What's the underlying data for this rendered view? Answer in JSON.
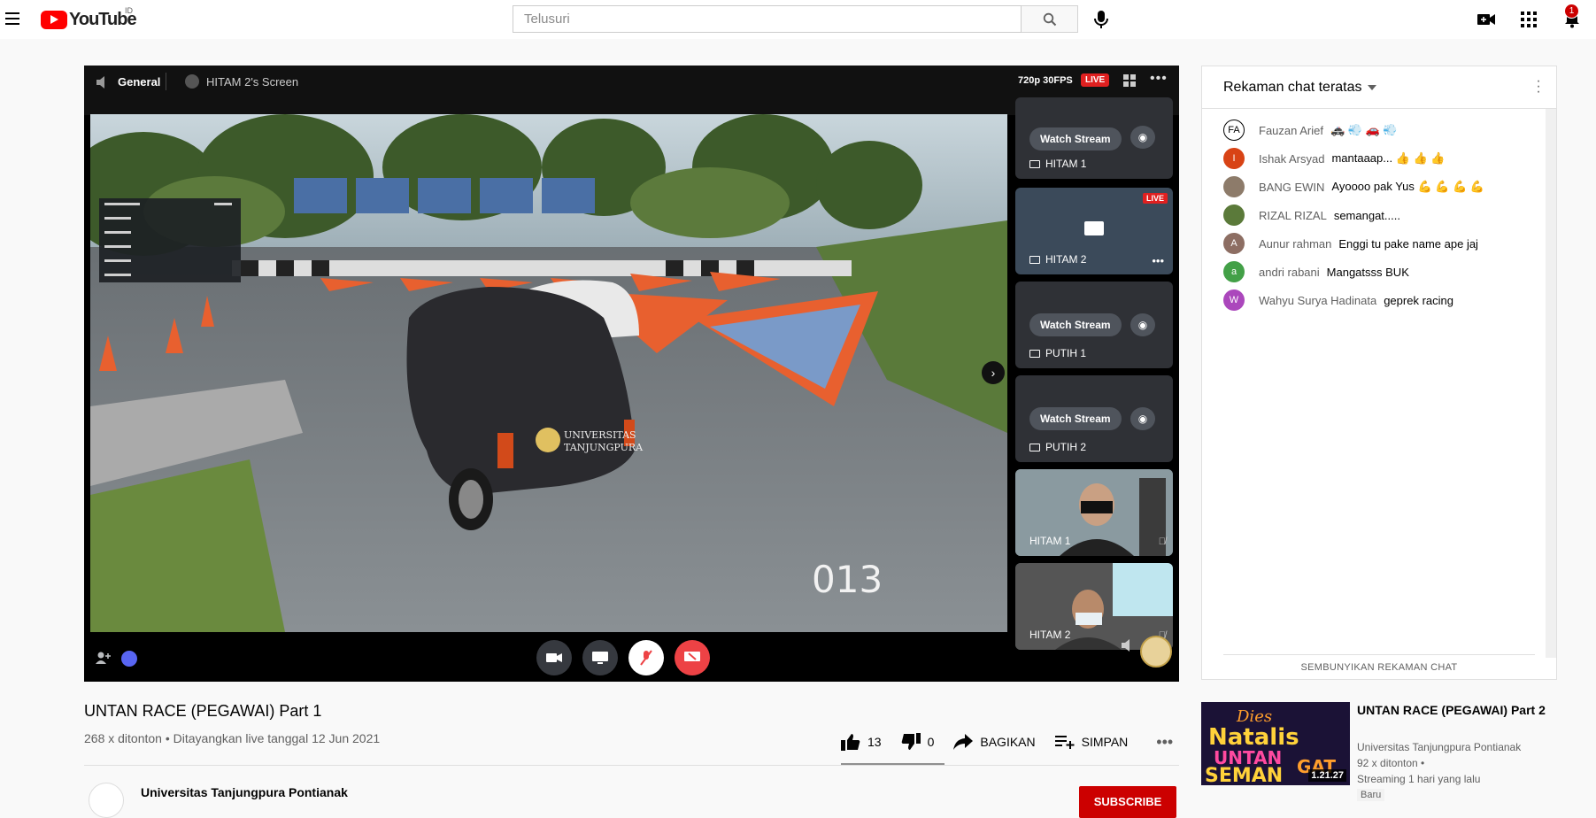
{
  "header": {
    "logo_text": "YouTube",
    "country_code": "ID",
    "search_placeholder": "Telusuri",
    "notification_count": "1"
  },
  "player": {
    "channel_name": "General",
    "screen_label": "HITAM 2's Screen",
    "quality": "720p 30FPS",
    "live_label": "LIVE",
    "overlay_lap_number": "013",
    "tiles": [
      {
        "label": "HITAM 1",
        "button": "Watch Stream"
      },
      {
        "label": "HITAM 2",
        "live": "LIVE"
      },
      {
        "label": "PUTIH 1",
        "button": "Watch Stream"
      },
      {
        "label": "PUTIH 2",
        "button": "Watch Stream"
      },
      {
        "label": "HITAM 1"
      },
      {
        "label": "HITAM 2"
      }
    ]
  },
  "video": {
    "title": "UNTAN RACE (PEGAWAI) Part 1",
    "meta": "268 x ditonton • Ditayangkan live tanggal 12 Jun 2021",
    "likes": "13",
    "dislikes": "0",
    "share_label": "BAGIKAN",
    "save_label": "SIMPAN",
    "channel_name": "Universitas Tanjungpura Pontianak",
    "subscribe_label": "SUBSCRIBE"
  },
  "chat": {
    "title": "Rekaman chat teratas",
    "footer": "SEMBUNYIKAN REKAMAN CHAT",
    "messages": [
      {
        "initial": "FA",
        "author": "Fauzan Arief",
        "text": "🚓 💨 🚗 💨",
        "color": "#ffffff"
      },
      {
        "initial": "I",
        "author": "Ishak Arsyad",
        "text": "mantaaap... 👍 👍 👍",
        "color": "#d84315"
      },
      {
        "initial": "",
        "author": "BANG EWIN",
        "text": "Ayoooo pak Yus 💪 💪 💪 💪",
        "color": "#8d7b6a"
      },
      {
        "initial": "",
        "author": "RIZAL RIZAL",
        "text": "semangat.....",
        "color": "#5b7a3a"
      },
      {
        "initial": "A",
        "author": "Aunur rahman",
        "text": "Enggi tu pake name ape jaj",
        "color": "#8d6e63"
      },
      {
        "initial": "a",
        "author": "andri rabani",
        "text": "Mangatsss BUK",
        "color": "#43a047"
      },
      {
        "initial": "W",
        "author": "Wahyu Surya Hadinata",
        "text": "geprek racing",
        "color": "#ab47bc"
      }
    ]
  },
  "recommendation": {
    "title": "UNTAN RACE (PEGAWAI) Part 2",
    "channel": "Universitas Tanjungpura Pontianak",
    "views": "92 x ditonton •",
    "time": "Streaming 1 hari yang lalu",
    "badge": "Baru",
    "thumb_duration": "1.21.27"
  }
}
